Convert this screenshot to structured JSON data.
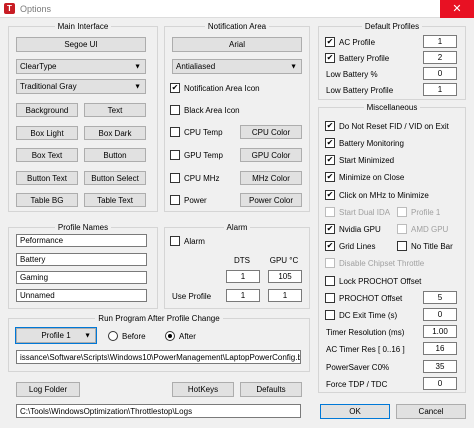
{
  "window": {
    "title": "Options",
    "close": "✕",
    "icon_letter": "T"
  },
  "main_interface": {
    "title": "Main Interface",
    "font_button": "Segoe UI",
    "render_select": "ClearType",
    "theme_select": "Traditional Gray",
    "buttons": [
      "Background",
      "Text",
      "Box Light",
      "Box Dark",
      "Box Text",
      "Button",
      "Button Text",
      "Button Select",
      "Table BG",
      "Table Text"
    ]
  },
  "notification": {
    "title": "Notification Area",
    "font_button": "Arial",
    "render_select": "Antialiased",
    "notif_icon": "Notification Area Icon",
    "black_icon": "Black Area Icon",
    "rows": [
      {
        "check": "CPU Temp",
        "button": "CPU Color"
      },
      {
        "check": "GPU Temp",
        "button": "GPU Color"
      },
      {
        "check": "CPU MHz",
        "button": "MHz Color"
      },
      {
        "check": "Power",
        "button": "Power Color"
      }
    ]
  },
  "default_profiles": {
    "title": "Default Profiles",
    "ac": {
      "label": "AC Profile",
      "value": "1"
    },
    "battery": {
      "label": "Battery Profile",
      "value": "2"
    },
    "low_pct": {
      "label": "Low Battery %",
      "value": "0"
    },
    "low_profile": {
      "label": "Low Battery Profile",
      "value": "1"
    }
  },
  "misc": {
    "title": "Miscellaneous",
    "no_reset": "Do Not Reset FID / VID on Exit",
    "battery_mon": "Battery Monitoring",
    "start_min": "Start Minimized",
    "min_close": "Minimize on Close",
    "click_mhz": "Click on MHz to Minimize",
    "start_dual": "Start Dual IDA",
    "profile1": "Profile 1",
    "nvidia": "Nvidia GPU",
    "amd": "AMD GPU",
    "grid": "Grid Lines",
    "no_title": "No Title Bar",
    "disable_chipset": "Disable Chipset Throttle",
    "lock_prochot": "Lock PROCHOT Offset",
    "prochot": {
      "label": "PROCHOT Offset",
      "value": "5"
    },
    "dc_exit": {
      "label": "DC Exit Time (s)",
      "value": "0"
    },
    "timer_res": {
      "label": "Timer Resolution (ms)",
      "value": "1.00"
    },
    "ac_timer": {
      "label": "AC Timer Res [ 0..16 ]",
      "value": "16"
    },
    "powersaver": {
      "label": "PowerSaver C0%",
      "value": "35"
    },
    "force_tdp": {
      "label": "Force TDP / TDC",
      "value": "0"
    }
  },
  "profile_names": {
    "title": "Profile Names",
    "names": [
      "Peformance",
      "Battery",
      "Gaming",
      "Unnamed"
    ]
  },
  "alarm": {
    "title": "Alarm",
    "check": "Alarm",
    "dts_header": "DTS",
    "gpu_header": "GPU °C",
    "dts_value": "1",
    "gpu_value": "105",
    "use_profile": "Use Profile",
    "use_dts": "1",
    "use_gpu": "1"
  },
  "run_program": {
    "title": "Run Program After Profile Change",
    "profile_select": "Profile 1",
    "before": "Before",
    "after": "After",
    "path": "issance\\Software\\Scripts\\Windows10\\PowerManagement\\LaptopPowerConfig.bat"
  },
  "bottom": {
    "log_folder": "Log Folder",
    "hotkeys": "HotKeys",
    "defaults": "Defaults",
    "log_path": "C:\\Tools\\WindowsOptimization\\Throttlestop\\Logs",
    "ok": "OK",
    "cancel": "Cancel"
  },
  "glyphs": {
    "check": "✔",
    "arrow": "▼"
  }
}
